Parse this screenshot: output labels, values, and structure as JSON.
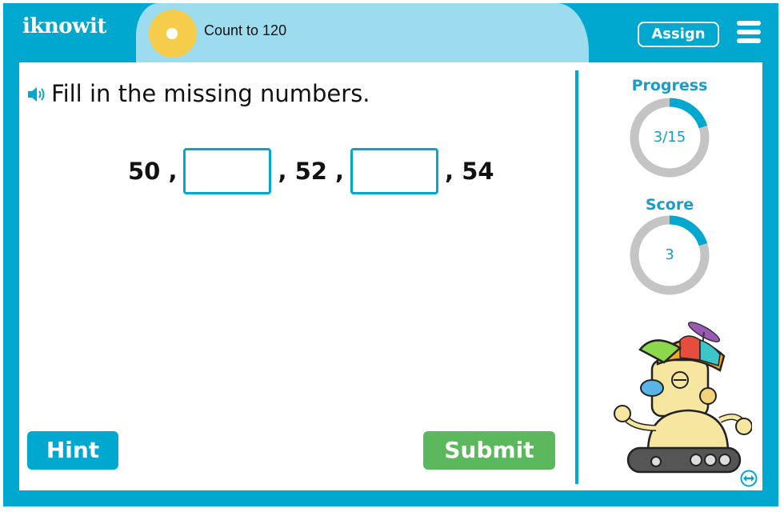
{
  "header": {
    "logo_text": "iknowit",
    "topic_title": "Count to 120",
    "assign_label": "Assign",
    "menu_icon": "hamburger-menu-icon"
  },
  "question": {
    "speaker_icon": "speaker-icon",
    "prompt": "Fill in the missing numbers.",
    "sequence": {
      "n1": "50 ,",
      "n2": ", 52 ,",
      "n3": ", 54"
    },
    "blanks": [
      {
        "value": "",
        "placeholder": ""
      },
      {
        "value": "",
        "placeholder": ""
      }
    ]
  },
  "buttons": {
    "hint_label": "Hint",
    "submit_label": "Submit"
  },
  "sidebar": {
    "progress": {
      "label": "Progress",
      "text": "3/15",
      "current": 3,
      "total": 15,
      "fraction": 0.2
    },
    "score": {
      "label": "Score",
      "text": "3",
      "fraction": 0.2
    },
    "mascot": "robot-mascot",
    "swap_icon": "swap-arrows-icon"
  },
  "colors": {
    "brand_blue": "#00a8cf",
    "light_blue": "#9ddcee",
    "yellow": "#f5cd4a",
    "submit_green": "#5cb85c",
    "ring_gray": "#c4c4c4"
  }
}
